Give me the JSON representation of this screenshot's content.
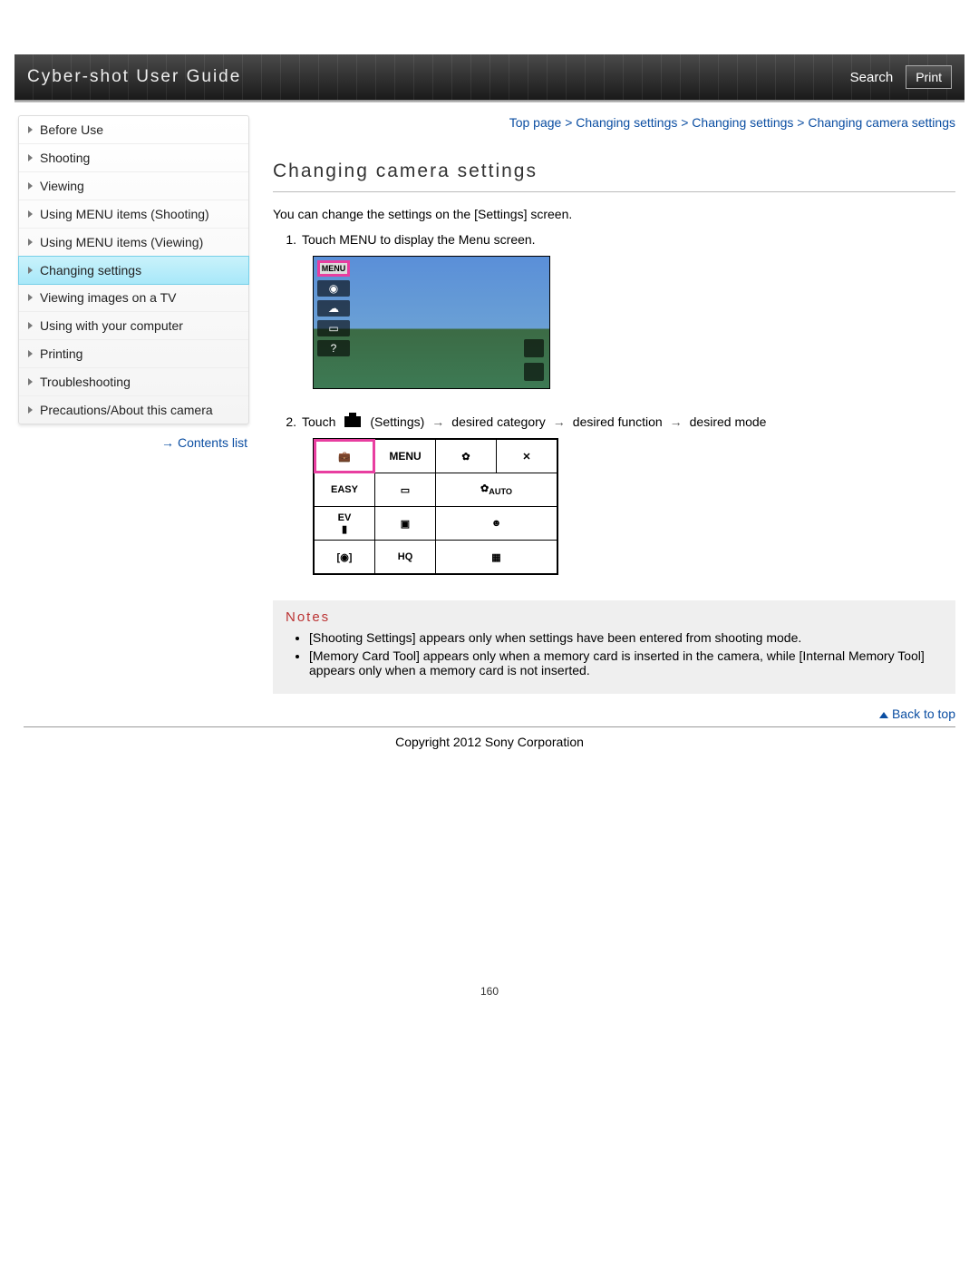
{
  "header": {
    "title": "Cyber-shot User Guide",
    "search": "Search",
    "print": "Print"
  },
  "sidebar": {
    "items": [
      "Before Use",
      "Shooting",
      "Viewing",
      "Using MENU items (Shooting)",
      "Using MENU items (Viewing)",
      "Changing settings",
      "Viewing images on a TV",
      "Using with your computer",
      "Printing",
      "Troubleshooting",
      "Precautions/About this camera"
    ],
    "active_index": 5,
    "contents_link": "Contents list"
  },
  "breadcrumb": "Top page > Changing settings > Changing settings > Changing camera settings",
  "main": {
    "heading": "Changing camera settings",
    "intro": "You can change the settings on the [Settings] screen.",
    "step1_num": "1.",
    "step1": "Touch MENU to display the Menu screen.",
    "step2_num": "2.",
    "step2_a": "Touch ",
    "step2_b": " (Settings) ",
    "step2_c": "desired category",
    "step2_d": "desired function",
    "step2_e": "desired mode",
    "menu_label": "MENU",
    "easy_label": "EASY",
    "hq_label": "HQ"
  },
  "notes": {
    "title": "Notes",
    "items": [
      "[Shooting Settings] appears only when settings have been entered from shooting mode.",
      "[Memory Card Tool] appears only when a memory card is inserted in the camera, while [Internal Memory Tool] appears only when a memory card is not inserted."
    ]
  },
  "back_to_top": "Back to top",
  "copyright": "Copyright 2012 Sony Corporation",
  "page_number": "160"
}
